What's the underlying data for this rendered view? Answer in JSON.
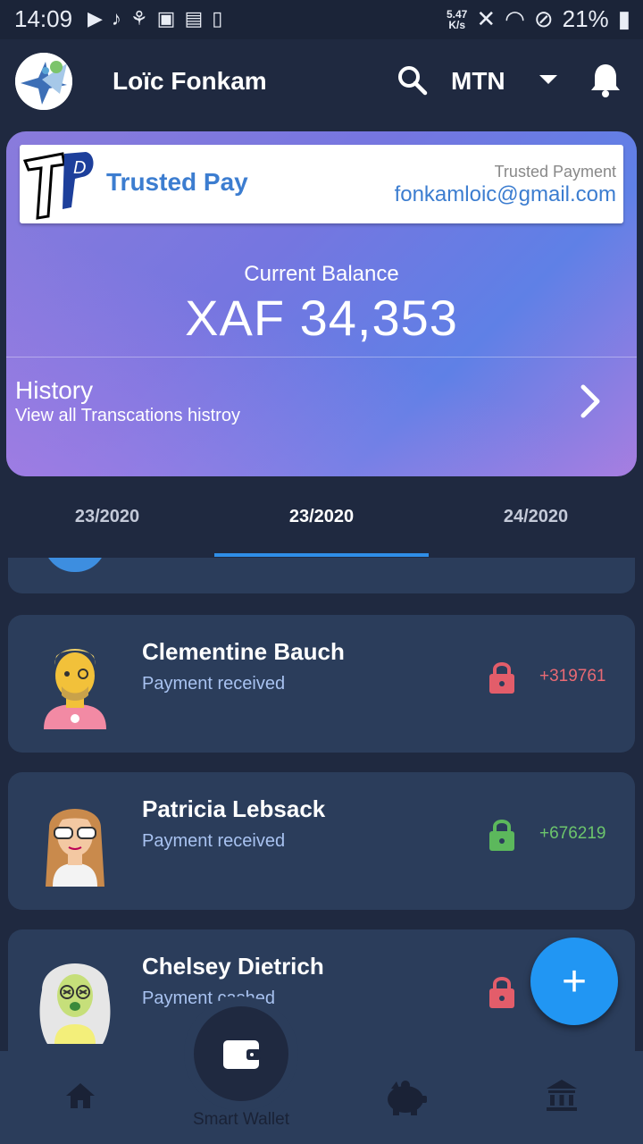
{
  "status_bar": {
    "time": "14:09",
    "speed_top": "5.47",
    "speed_bottom": "K/s",
    "battery": "21%"
  },
  "header": {
    "user_name": "Loïc Fonkam",
    "carrier": "MTN"
  },
  "card": {
    "brand": "Trusted Pay",
    "subtitle": "Trusted Payment",
    "email": "fonkamloic@gmail.com",
    "balance_label": "Current Balance",
    "balance_value": "XAF 34,353",
    "history_title": "History",
    "history_subtitle": "View all Transcations histroy"
  },
  "tabs": [
    {
      "label": "23/2020"
    },
    {
      "label": "23/2020"
    },
    {
      "label": "24/2020"
    }
  ],
  "transactions": [
    {
      "name": "Clementine Bauch",
      "status": "Payment received",
      "amount": "+319761",
      "lock_color": "#e35d6a",
      "amount_color": "#e96a74"
    },
    {
      "name": "Patricia Lebsack",
      "status": "Payment received",
      "amount": "+676219",
      "lock_color": "#5cb85c",
      "amount_color": "#6cc56c"
    },
    {
      "name": "Chelsey Dietrich",
      "status": "Payment cashed",
      "amount": "",
      "lock_color": "#e35d6a",
      "amount_color": "#e96a74"
    }
  ],
  "bottom_nav": {
    "center_label": "Smart Wallet",
    "items": [
      "home-icon",
      "piggy-bank-icon",
      "bank-icon"
    ]
  },
  "fab_symbol": "+"
}
